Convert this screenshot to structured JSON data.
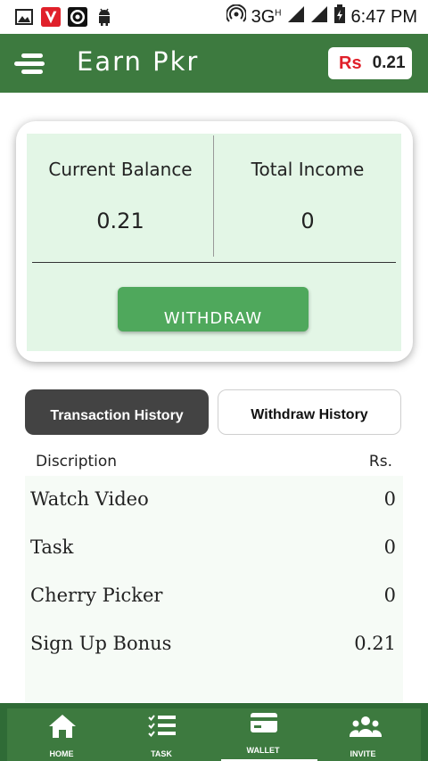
{
  "status_bar": {
    "network": "3G",
    "network_sup": "H",
    "time": "6:47 PM",
    "icons": [
      "image-icon",
      "vlc-v-icon",
      "circle-app-icon",
      "android-icon",
      "hotspot-icon",
      "signal-icon",
      "signal-icon",
      "battery-icon"
    ]
  },
  "app_bar": {
    "title": "Earn Pkr",
    "currency_symbol": "Rs",
    "balance": "0.21",
    "bg_color": "#3d7a3f"
  },
  "wallet_card": {
    "current_balance_label": "Current Balance",
    "current_balance_value": "0.21",
    "total_income_label": "Total Income",
    "total_income_value": "0",
    "withdraw_label": "WITHDRAW",
    "button_color": "#4fa85c",
    "panel_color": "#e3f6e6"
  },
  "tabs": [
    {
      "label": "Transaction History",
      "active": true
    },
    {
      "label": "Withdraw History",
      "active": false
    }
  ],
  "transactions": {
    "header_description": "Discription",
    "header_amount": "Rs.",
    "rows": [
      {
        "label": "Watch Video",
        "value": "0"
      },
      {
        "label": "Task",
        "value": "0"
      },
      {
        "label": "Cherry Picker",
        "value": "0"
      },
      {
        "label": "Sign Up Bonus",
        "value": "0.21"
      }
    ]
  },
  "bottom_nav": {
    "items": [
      {
        "label": "HOME",
        "icon": "home-icon"
      },
      {
        "label": "TASK",
        "icon": "task-list-icon"
      },
      {
        "label": "WALLET",
        "icon": "wallet-card-icon",
        "active": true
      },
      {
        "label": "INVITE",
        "icon": "users-icon"
      }
    ]
  }
}
